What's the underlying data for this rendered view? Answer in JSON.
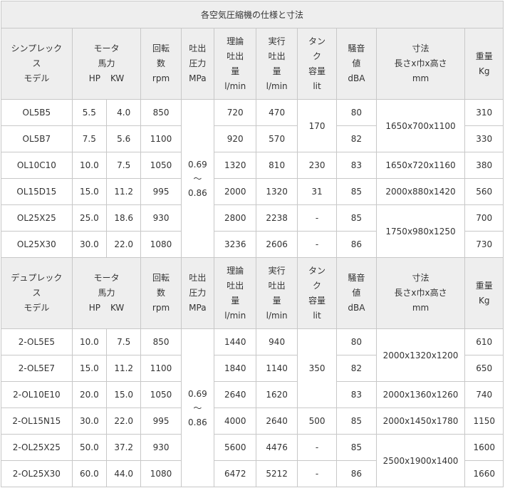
{
  "caption": "各空気圧縮機の仕様と寸法",
  "sections": [
    {
      "header": {
        "model": [
          "シンプレック",
          "ス",
          "モデル"
        ],
        "motor": [
          "モータ",
          "馬力"
        ],
        "hp": "HP",
        "kw": "KW",
        "speed": [
          "回転",
          "数",
          "rpm"
        ],
        "pressure": [
          "吐出",
          "圧力",
          "MPa"
        ],
        "theory": [
          "理論",
          "吐出",
          "量",
          "l/min"
        ],
        "actual": [
          "実行",
          "吐出",
          "量",
          "l/min"
        ],
        "tank": [
          "タン",
          "ク",
          "容量",
          "lit"
        ],
        "noise": [
          "騒音",
          "値",
          "dBA"
        ],
        "dims": [
          "寸法",
          "長さx巾x高さ",
          "mm"
        ],
        "weight": [
          "重量",
          "Kg"
        ]
      },
      "pressure_value": [
        "0.69",
        "～",
        "0.86"
      ],
      "rows": [
        {
          "model": "OL5B5",
          "hp": "5.5",
          "kw": "4.0",
          "rpm": "850",
          "theory": "720",
          "actual": "470",
          "noise": "80",
          "weight": "310"
        },
        {
          "model": "OL5B7",
          "hp": "7.5",
          "kw": "5.6",
          "rpm": "1100",
          "theory": "920",
          "actual": "570",
          "noise": "82",
          "weight": "330"
        },
        {
          "model": "OL10C10",
          "hp": "10.0",
          "kw": "7.5",
          "rpm": "1050",
          "theory": "1320",
          "actual": "810",
          "noise": "83",
          "weight": "380"
        },
        {
          "model": "OL15D15",
          "hp": "15.0",
          "kw": "11.2",
          "rpm": "995",
          "theory": "2000",
          "actual": "1320",
          "noise": "85",
          "weight": "560"
        },
        {
          "model": "OL25X25",
          "hp": "25.0",
          "kw": "18.6",
          "rpm": "930",
          "theory": "2800",
          "actual": "2238",
          "noise": "85",
          "weight": "700"
        },
        {
          "model": "OL25X30",
          "hp": "30.0",
          "kw": "22.0",
          "rpm": "1080",
          "theory": "3236",
          "actual": "2606",
          "noise": "86",
          "weight": "730"
        }
      ],
      "tank": [
        "170",
        "230",
        "31",
        "-",
        "-"
      ],
      "dims": [
        "1650x700x1100",
        "1650x720x1160",
        "2000x880x1420",
        "1750x980x1250"
      ]
    },
    {
      "header": {
        "model": [
          "デュプレック",
          "ス",
          "モデル"
        ],
        "motor": [
          "モータ",
          "馬力"
        ],
        "hp": "HP",
        "kw": "KW",
        "speed": [
          "回転",
          "数",
          "rpm"
        ],
        "pressure": [
          "吐出",
          "圧力",
          "MPa"
        ],
        "theory": [
          "理論",
          "吐出",
          "量",
          "l/min"
        ],
        "actual": [
          "実行",
          "吐出",
          "量",
          "l/min"
        ],
        "tank": [
          "タン",
          "ク",
          "容量",
          "lit"
        ],
        "noise": [
          "騒音",
          "値",
          "dBA"
        ],
        "dims": [
          "寸法",
          "長さx巾x高さ",
          "mm"
        ],
        "weight": [
          "重量",
          "Kg"
        ]
      },
      "pressure_value": [
        "0.69",
        "～",
        "0.86"
      ],
      "rows": [
        {
          "model": "2-OL5E5",
          "hp": "10.0",
          "kw": "7.5",
          "rpm": "850",
          "theory": "1440",
          "actual": "940",
          "noise": "80",
          "weight": "610"
        },
        {
          "model": "2-OL5E7",
          "hp": "15.0",
          "kw": "11.2",
          "rpm": "1100",
          "theory": "1840",
          "actual": "1140",
          "noise": "82",
          "weight": "650"
        },
        {
          "model": "2-OL10E10",
          "hp": "20.0",
          "kw": "15.0",
          "rpm": "1050",
          "theory": "2640",
          "actual": "1620",
          "noise": "83",
          "weight": "740"
        },
        {
          "model": "2-OL15N15",
          "hp": "30.0",
          "kw": "22.0",
          "rpm": "995",
          "theory": "4000",
          "actual": "2640",
          "noise": "85",
          "weight": "1150"
        },
        {
          "model": "2-OL25X25",
          "hp": "50.0",
          "kw": "37.2",
          "rpm": "930",
          "theory": "5600",
          "actual": "4476",
          "noise": "85",
          "weight": "1600"
        },
        {
          "model": "2-OL25X30",
          "hp": "60.0",
          "kw": "44.0",
          "rpm": "1080",
          "theory": "6472",
          "actual": "5212",
          "noise": "86",
          "weight": "1660"
        }
      ],
      "tank": [
        "350",
        "500",
        "-",
        "-"
      ],
      "dims": [
        "2000x1320x1200",
        "2000x1360x1260",
        "2000x1450x1780",
        "2500x1900x1400"
      ]
    }
  ]
}
